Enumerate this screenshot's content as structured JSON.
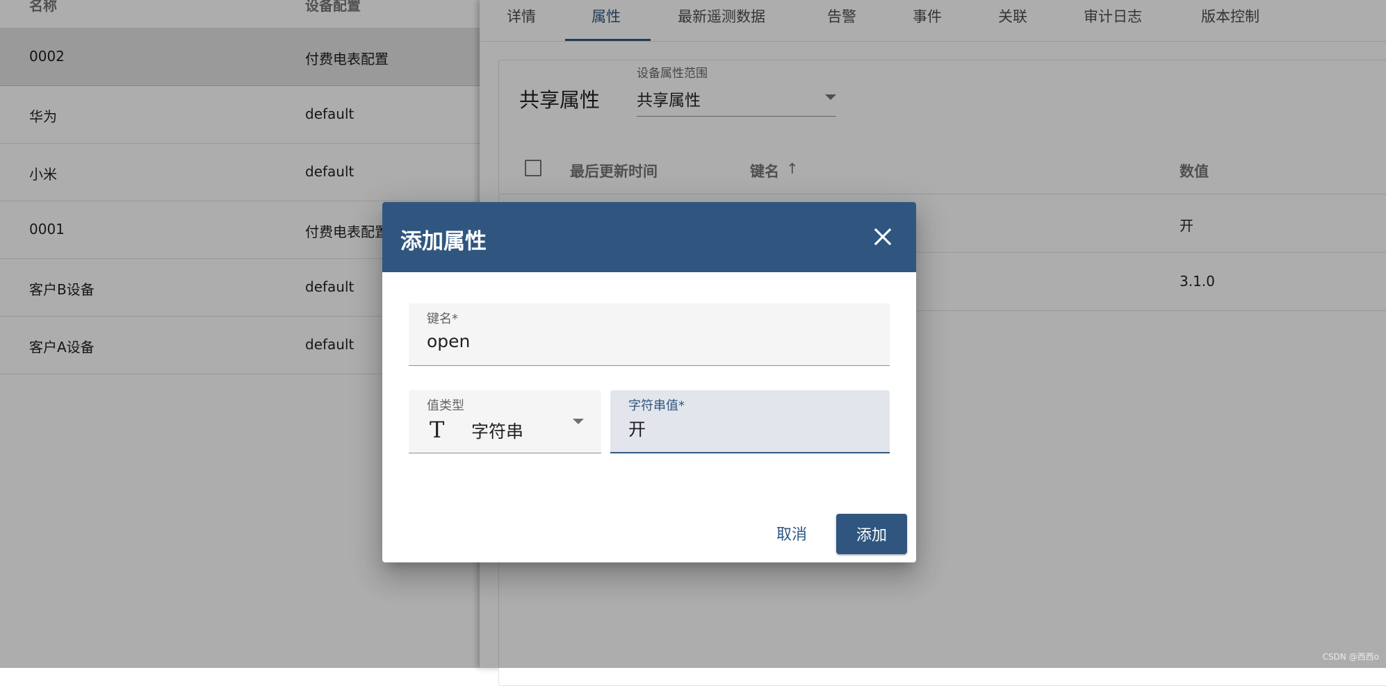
{
  "device_table": {
    "headers": {
      "name": "名称",
      "profile": "设备配置"
    },
    "rows": [
      {
        "name": "0002",
        "profile": "付费电表配置",
        "selected": true
      },
      {
        "name": "华为",
        "profile": "default"
      },
      {
        "name": "小米",
        "profile": "default"
      },
      {
        "name": "0001",
        "profile": "付费电表配置"
      },
      {
        "name": "客户B设备",
        "profile": "default"
      },
      {
        "name": "客户A设备",
        "profile": "default"
      }
    ]
  },
  "details": {
    "tabs": [
      {
        "label": "详情"
      },
      {
        "label": "属性",
        "active": true
      },
      {
        "label": "最新遥测数据"
      },
      {
        "label": "告警"
      },
      {
        "label": "事件"
      },
      {
        "label": "关联"
      },
      {
        "label": "审计日志"
      },
      {
        "label": "版本控制"
      }
    ],
    "attributes": {
      "title": "共享属性",
      "scope_label": "设备属性范围",
      "scope_value": "共享属性",
      "columns": {
        "last_update": "最后更新时间",
        "key": "键名",
        "value": "数值"
      },
      "rows": [
        {
          "value": "开"
        },
        {
          "value": "3.1.0"
        }
      ]
    }
  },
  "dialog": {
    "title": "添加属性",
    "key_field": {
      "label": "键名*",
      "value": "open"
    },
    "value_type": {
      "label": "值类型",
      "icon": "text-type-icon",
      "icon_glyph": "T",
      "value": "字符串"
    },
    "string_value": {
      "label": "字符串值*",
      "value": "开"
    },
    "cancel_label": "取消",
    "add_label": "添加"
  },
  "colors": {
    "primary": "#305680",
    "backdrop": "rgba(0,0,0,0.32)"
  },
  "watermark": "CSDN @西西o"
}
